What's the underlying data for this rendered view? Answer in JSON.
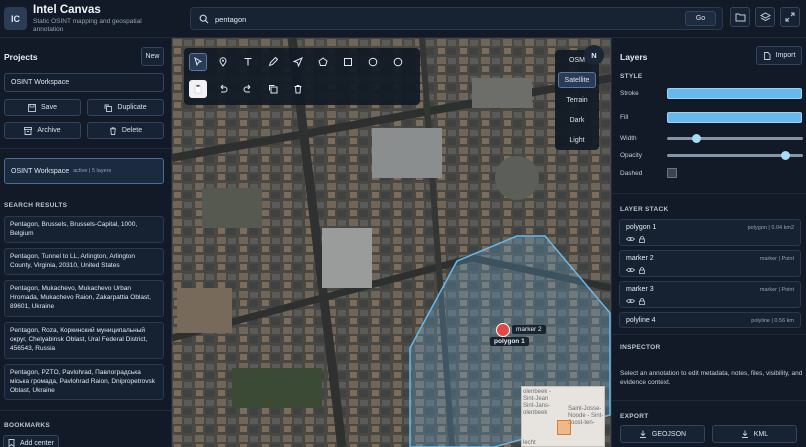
{
  "app": {
    "logo": "IC",
    "title": "Intel Canvas",
    "subtitle": "Static OSINT mapping and geospatial annotation"
  },
  "search": {
    "value": "pentagon",
    "go_label": "Go"
  },
  "header_icons": [
    "folder-icon",
    "layers-icon",
    "fullscreen-icon"
  ],
  "projects": {
    "title": "Projects",
    "new_label": "New",
    "name_value": "OSINT Workspace",
    "save_label": "Save",
    "duplicate_label": "Duplicate",
    "archive_label": "Archive",
    "delete_label": "Delete",
    "items": [
      {
        "name": "OSINT Workspace",
        "meta": "active | 5 layers"
      }
    ]
  },
  "search_results": {
    "title": "SEARCH RESULTS",
    "items": [
      "Pentagon, Brussels, Brussels-Capital, 1000, Belgium",
      "Pentagon, Tunnel to LL, Arlington, Arlington County, Virginia, 20310, United States",
      "Pentagon, Mukachevo, Mukachevo Urban Hromada, Mukachevo Raion, Zakarpattia Oblast, 89601, Ukraine",
      "Pentagon, Roza, Коркинский муниципальный округ, Chelyabinsk Oblast, Ural Federal District, 456543, Russia",
      "Pentagon, PZTO, Pavlohrad, Павлоградська міська громада, Pavlohrad Raion, Dnipropetrovsk Oblast, Ukraine"
    ]
  },
  "bookmarks": {
    "title": "BOOKMARKS",
    "add_label": "Add center"
  },
  "map": {
    "basemaps": [
      "OSM",
      "Satellite",
      "Terrain",
      "Dark",
      "Light"
    ],
    "active_basemap": "Satellite",
    "north_label": "N",
    "marker_label": "marker 2",
    "polygon_label": "polygon 1",
    "minimap_lines": [
      "olenbeek -",
      "Sint-Jean",
      "Sint-Jans-",
      "olenbeek",
      "Saint-Josse-",
      "Noode - Sint-",
      "Joost-ten-",
      "lecht"
    ]
  },
  "tools": [
    "select-icon",
    "pin-icon",
    "text-icon",
    "pencil-icon",
    "send-icon",
    "pentagon-icon",
    "square-icon",
    "circle-icon",
    "circle-outline-icon",
    "clipboard-icon",
    "undo-icon",
    "redo-icon",
    "copy-icon",
    "trash-icon"
  ],
  "layers_panel": {
    "title": "Layers",
    "import_label": "Import",
    "style_title": "STYLE",
    "stroke_label": "Stroke",
    "fill_label": "Fill",
    "width_label": "Width",
    "opacity_label": "Opacity",
    "dashed_label": "Dashed",
    "stroke_color": "#67b9ec",
    "fill_color": "#67b9ec",
    "width_value": 0.2,
    "opacity_value": 0.9,
    "stack_title": "LAYER STACK",
    "stack": [
      {
        "name": "polygon 1",
        "meta": "polygon | 0.04 km2"
      },
      {
        "name": "marker 2",
        "meta": "marker | Point"
      },
      {
        "name": "marker 3",
        "meta": "marker | Point"
      },
      {
        "name": "polyline 4",
        "meta": "polyline | 0.56 km"
      }
    ],
    "inspector_title": "INSPECTOR",
    "inspector_text": "Select an annotation to edit metadata, notes, files, visibility, and evidence context.",
    "export_title": "EXPORT",
    "geojson_label": "GEOJSON",
    "kml_label": "KML"
  }
}
